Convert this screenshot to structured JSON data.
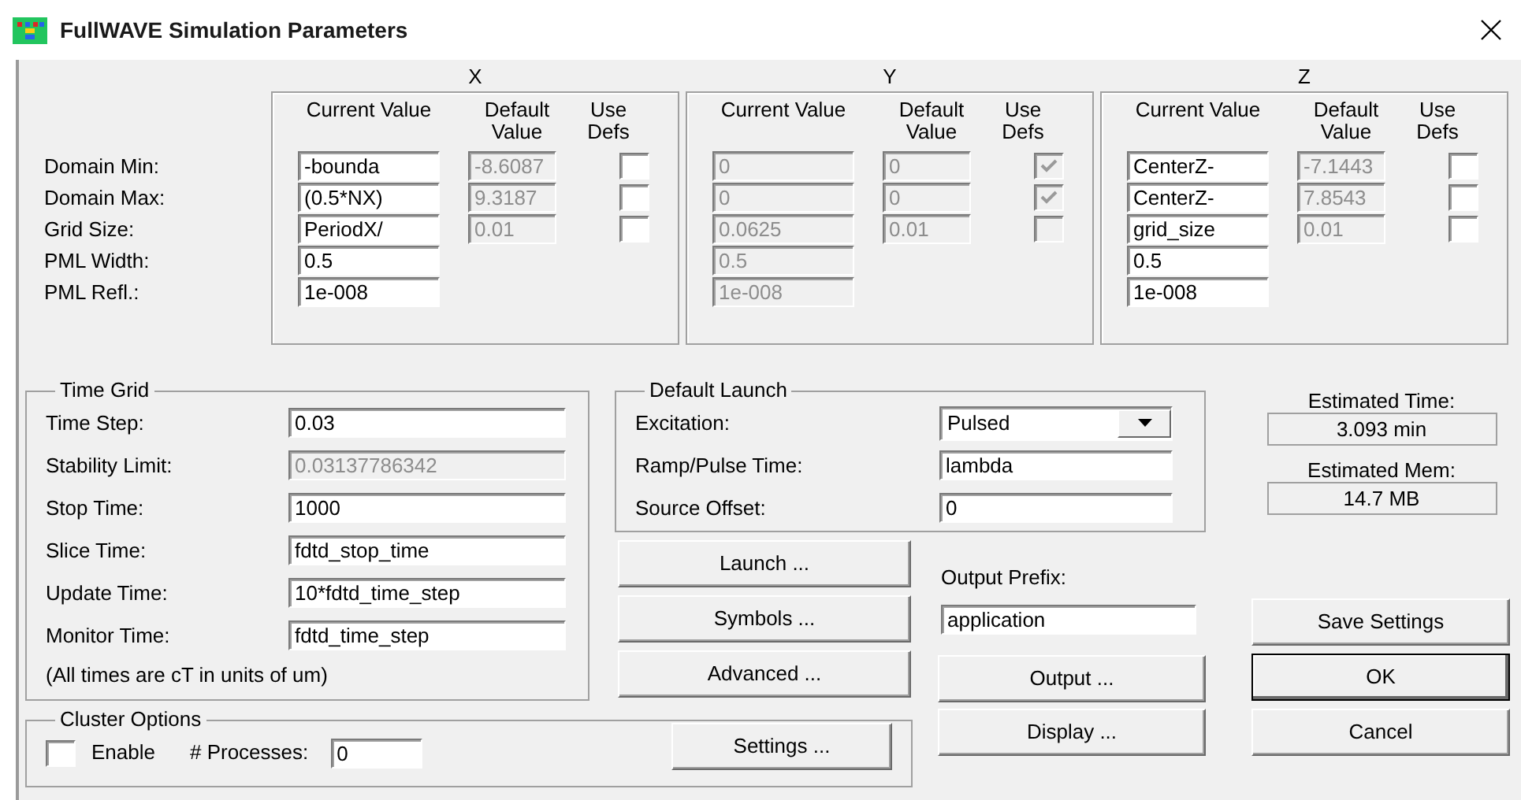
{
  "window": {
    "title": "FullWAVE Simulation Parameters"
  },
  "axis_rows": [
    "Domain Min:",
    "Domain Max:",
    "Grid Size:",
    "PML Width:",
    "PML Refl.:"
  ],
  "axes": [
    {
      "label": "X",
      "columns": [
        "Current Value",
        "Default Value",
        "Use Defs"
      ],
      "disabled": false,
      "fields": [
        {
          "current": "-bounda",
          "default": "-8.6087",
          "use_defaults": false
        },
        {
          "current": "(0.5*NX)",
          "default": "9.3187",
          "use_defaults": false
        },
        {
          "current": "PeriodX/",
          "default": "0.01",
          "use_defaults": false
        },
        {
          "current": "0.5"
        },
        {
          "current": "1e-008"
        }
      ]
    },
    {
      "label": "Y",
      "columns": [
        "Current Value",
        "Default Value",
        "Use Defs"
      ],
      "disabled": true,
      "fields": [
        {
          "current": "0",
          "default": "0",
          "use_defaults": true
        },
        {
          "current": "0",
          "default": "0",
          "use_defaults": true
        },
        {
          "current": "0.0625",
          "default": "0.01",
          "use_defaults": false
        },
        {
          "current": "0.5"
        },
        {
          "current": "1e-008"
        }
      ]
    },
    {
      "label": "Z",
      "columns": [
        "Current Value",
        "Default Value",
        "Use Defs"
      ],
      "disabled": false,
      "fields": [
        {
          "current": "CenterZ-",
          "default": "-7.1443",
          "use_defaults": false
        },
        {
          "current": "CenterZ-",
          "default": "7.8543",
          "use_defaults": false
        },
        {
          "current": "grid_size",
          "default": "0.01",
          "use_defaults": false
        },
        {
          "current": "0.5"
        },
        {
          "current": "1e-008"
        }
      ]
    }
  ],
  "time_grid": {
    "title": "Time Grid",
    "rows": [
      {
        "label": "Time Step:",
        "value": "0.03",
        "disabled": false
      },
      {
        "label": "Stability Limit:",
        "value": "0.03137786342",
        "disabled": true
      },
      {
        "label": "Stop Time:",
        "value": "1000",
        "disabled": false
      },
      {
        "label": "Slice Time:",
        "value": "fdtd_stop_time",
        "disabled": false
      },
      {
        "label": "Update Time:",
        "value": "10*fdtd_time_step",
        "disabled": false
      },
      {
        "label": "Monitor Time:",
        "value": "fdtd_time_step",
        "disabled": false
      }
    ],
    "note": "(All times are cT in units of um)"
  },
  "default_launch": {
    "title": "Default Launch",
    "rows": [
      {
        "kind": "select",
        "label": "Excitation:",
        "value": "Pulsed"
      },
      {
        "kind": "input",
        "label": "Ramp/Pulse Time:",
        "value": "lambda"
      },
      {
        "kind": "input",
        "label": "Source Offset:",
        "value": "0"
      }
    ]
  },
  "estimates": [
    {
      "label": "Estimated Time:",
      "value": "3.093 min"
    },
    {
      "label": "Estimated Mem:",
      "value": "14.7 MB"
    }
  ],
  "action_buttons": [
    "Launch ...",
    "Symbols ...",
    "Advanced ..."
  ],
  "output_prefix": {
    "label": "Output Prefix:",
    "value": "application"
  },
  "output_buttons": [
    "Output ...",
    "Display ..."
  ],
  "dialog_buttons": [
    {
      "label": "Save Settings",
      "default": false
    },
    {
      "label": "OK",
      "default": true
    },
    {
      "label": "Cancel",
      "default": false
    }
  ],
  "cluster": {
    "title": "Cluster Options",
    "enable_label": "Enable",
    "enabled": false,
    "processes_label": "# Processes:",
    "processes": "0",
    "settings_button": "Settings ..."
  }
}
